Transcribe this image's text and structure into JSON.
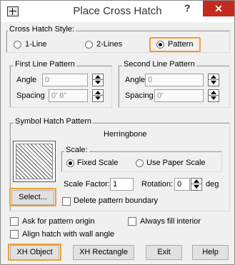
{
  "window": {
    "title": "Place Cross Hatch",
    "help": "?",
    "close": "✕"
  },
  "style_group": {
    "label": "Cross Hatch Style:",
    "opt1": "1-Line",
    "opt2": "2-Lines",
    "opt3": "Pattern",
    "selected": "Pattern"
  },
  "first_line": {
    "label": "First Line Pattern",
    "angle_label": "Angle",
    "angle_value": "0",
    "spacing_label": "Spacing",
    "spacing_value": "0' 6\""
  },
  "second_line": {
    "label": "Second Line Pattern",
    "angle_label": "Angle",
    "angle_value": "0",
    "spacing_label": "Spacing",
    "spacing_value": "0'"
  },
  "symbol": {
    "label": "Symbol Hatch Pattern",
    "pattern_name": "Herringbone",
    "scale_label": "Scale:",
    "fixed_scale": "Fixed Scale",
    "paper_scale": "Use Paper Scale",
    "scale_factor_label": "Scale Factor:",
    "scale_factor_value": "1",
    "rotation_label": "Rotation:",
    "rotation_value": "0",
    "deg": "deg",
    "select_button": "Select...",
    "delete_boundary": "Delete pattern boundary"
  },
  "options": {
    "ask_origin": "Ask for pattern origin",
    "always_fill": "Always fill interior",
    "align_wall": "Align hatch with wall angle"
  },
  "buttons": {
    "xh_object": "XH Object",
    "xh_rectangle": "XH Rectangle",
    "exit": "Exit",
    "help": "Help"
  },
  "colors": {
    "highlight": "#f0a030",
    "close_bg": "#c42b1c"
  },
  "icons": {
    "app": "crosshatch-app-icon",
    "preview": "herringbone-pattern-preview"
  }
}
